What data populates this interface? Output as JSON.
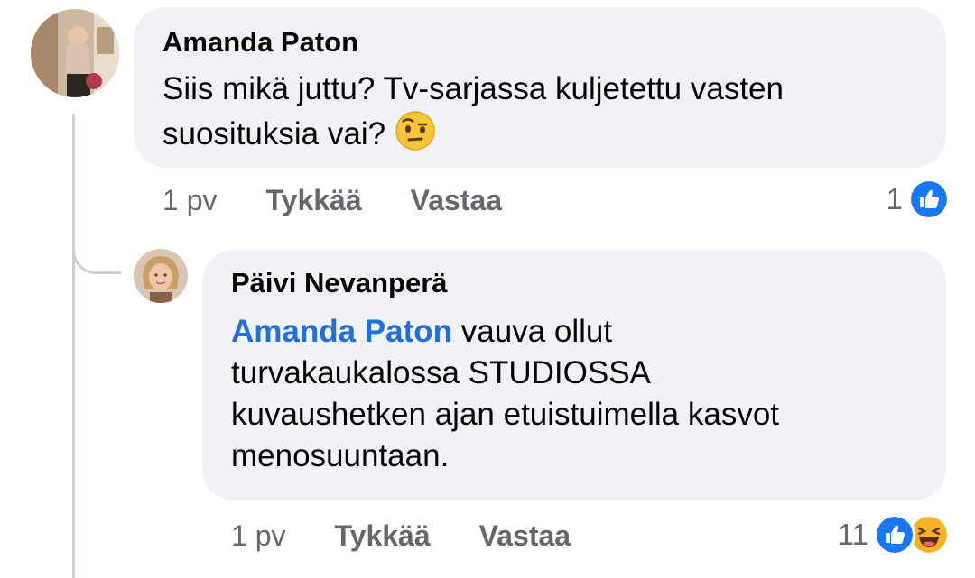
{
  "comments": [
    {
      "author": "Amanda Paton",
      "text_line1": "Siis mikä juttu? Tv-sarjassa kuljetettu vasten",
      "text_line2": "suosituksia vai?",
      "emoji": "raised-eyebrow-emoji",
      "time": "1 pv",
      "like_label": "Tykkää",
      "reply_label": "Vastaa",
      "reaction_count": "1",
      "reactions": [
        "like-reaction-icon"
      ]
    },
    {
      "author": "Päivi Nevanperä",
      "mention": "Amanda Paton",
      "text_line1": " vauva ollut",
      "text_line2": "turvakaukalossa STUDIOSSA",
      "text_line3": "kuvaushetken ajan etuistuimella kasvot",
      "text_line4": "menosuuntaan.",
      "time": "1 pv",
      "like_label": "Tykkää",
      "reply_label": "Vastaa",
      "reaction_count": "11",
      "reactions": [
        "like-reaction-icon",
        "haha-reaction-icon"
      ]
    }
  ],
  "colors": {
    "bubble": "#f0f2f5",
    "mention": "#216fdb",
    "meta": "#65676b",
    "like_blue": "#1877f2",
    "haha_yellow": "#f7b125"
  }
}
